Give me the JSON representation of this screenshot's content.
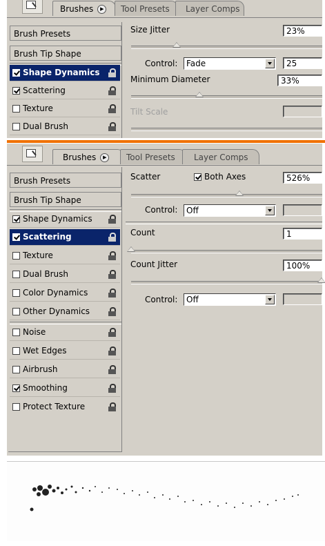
{
  "colors": {
    "panel": "#d4d0c8",
    "selection": "#0a246a",
    "divider": "#f07000"
  },
  "top_panel": {
    "tabs": [
      "Brushes",
      "Tool Presets",
      "Layer Comps"
    ],
    "sidebar": {
      "presets_label": "Brush Presets",
      "tip_shape_label": "Brush Tip Shape",
      "items": [
        {
          "label": "Shape Dynamics",
          "checked": true,
          "selected": true
        },
        {
          "label": "Scattering",
          "checked": true,
          "selected": false
        },
        {
          "label": "Texture",
          "checked": false,
          "selected": false
        },
        {
          "label": "Dual Brush",
          "checked": false,
          "selected": false
        }
      ]
    },
    "content": {
      "size_jitter_label": "Size Jitter",
      "size_jitter_value": "23%",
      "control_label": "Control:",
      "control_value": "Fade",
      "fade_steps": "25",
      "min_diameter_label": "Minimum Diameter",
      "min_diameter_value": "33%",
      "tilt_scale_label": "Tilt Scale"
    }
  },
  "bottom_panel": {
    "tabs": [
      "Brushes",
      "Tool Presets",
      "Layer Comps"
    ],
    "sidebar": {
      "presets_label": "Brush Presets",
      "tip_shape_label": "Brush Tip Shape",
      "items": [
        {
          "label": "Shape Dynamics",
          "checked": true,
          "selected": false
        },
        {
          "label": "Scattering",
          "checked": true,
          "selected": true
        },
        {
          "label": "Texture",
          "checked": false,
          "selected": false
        },
        {
          "label": "Dual Brush",
          "checked": false,
          "selected": false
        },
        {
          "label": "Color Dynamics",
          "checked": false,
          "selected": false
        },
        {
          "label": "Other Dynamics",
          "checked": false,
          "selected": false
        }
      ],
      "extra_items": [
        {
          "label": "Noise",
          "checked": false
        },
        {
          "label": "Wet Edges",
          "checked": false
        },
        {
          "label": "Airbrush",
          "checked": false
        },
        {
          "label": "Smoothing",
          "checked": true
        },
        {
          "label": "Protect Texture",
          "checked": false
        }
      ]
    },
    "content": {
      "scatter_label": "Scatter",
      "both_axes_label": "Both Axes",
      "both_axes_checked": true,
      "scatter_value": "526%",
      "control1_label": "Control:",
      "control1_value": "Off",
      "count_label": "Count",
      "count_value": "1",
      "count_jitter_label": "Count Jitter",
      "count_jitter_value": "100%",
      "control2_label": "Control:",
      "control2_value": "Off"
    }
  }
}
